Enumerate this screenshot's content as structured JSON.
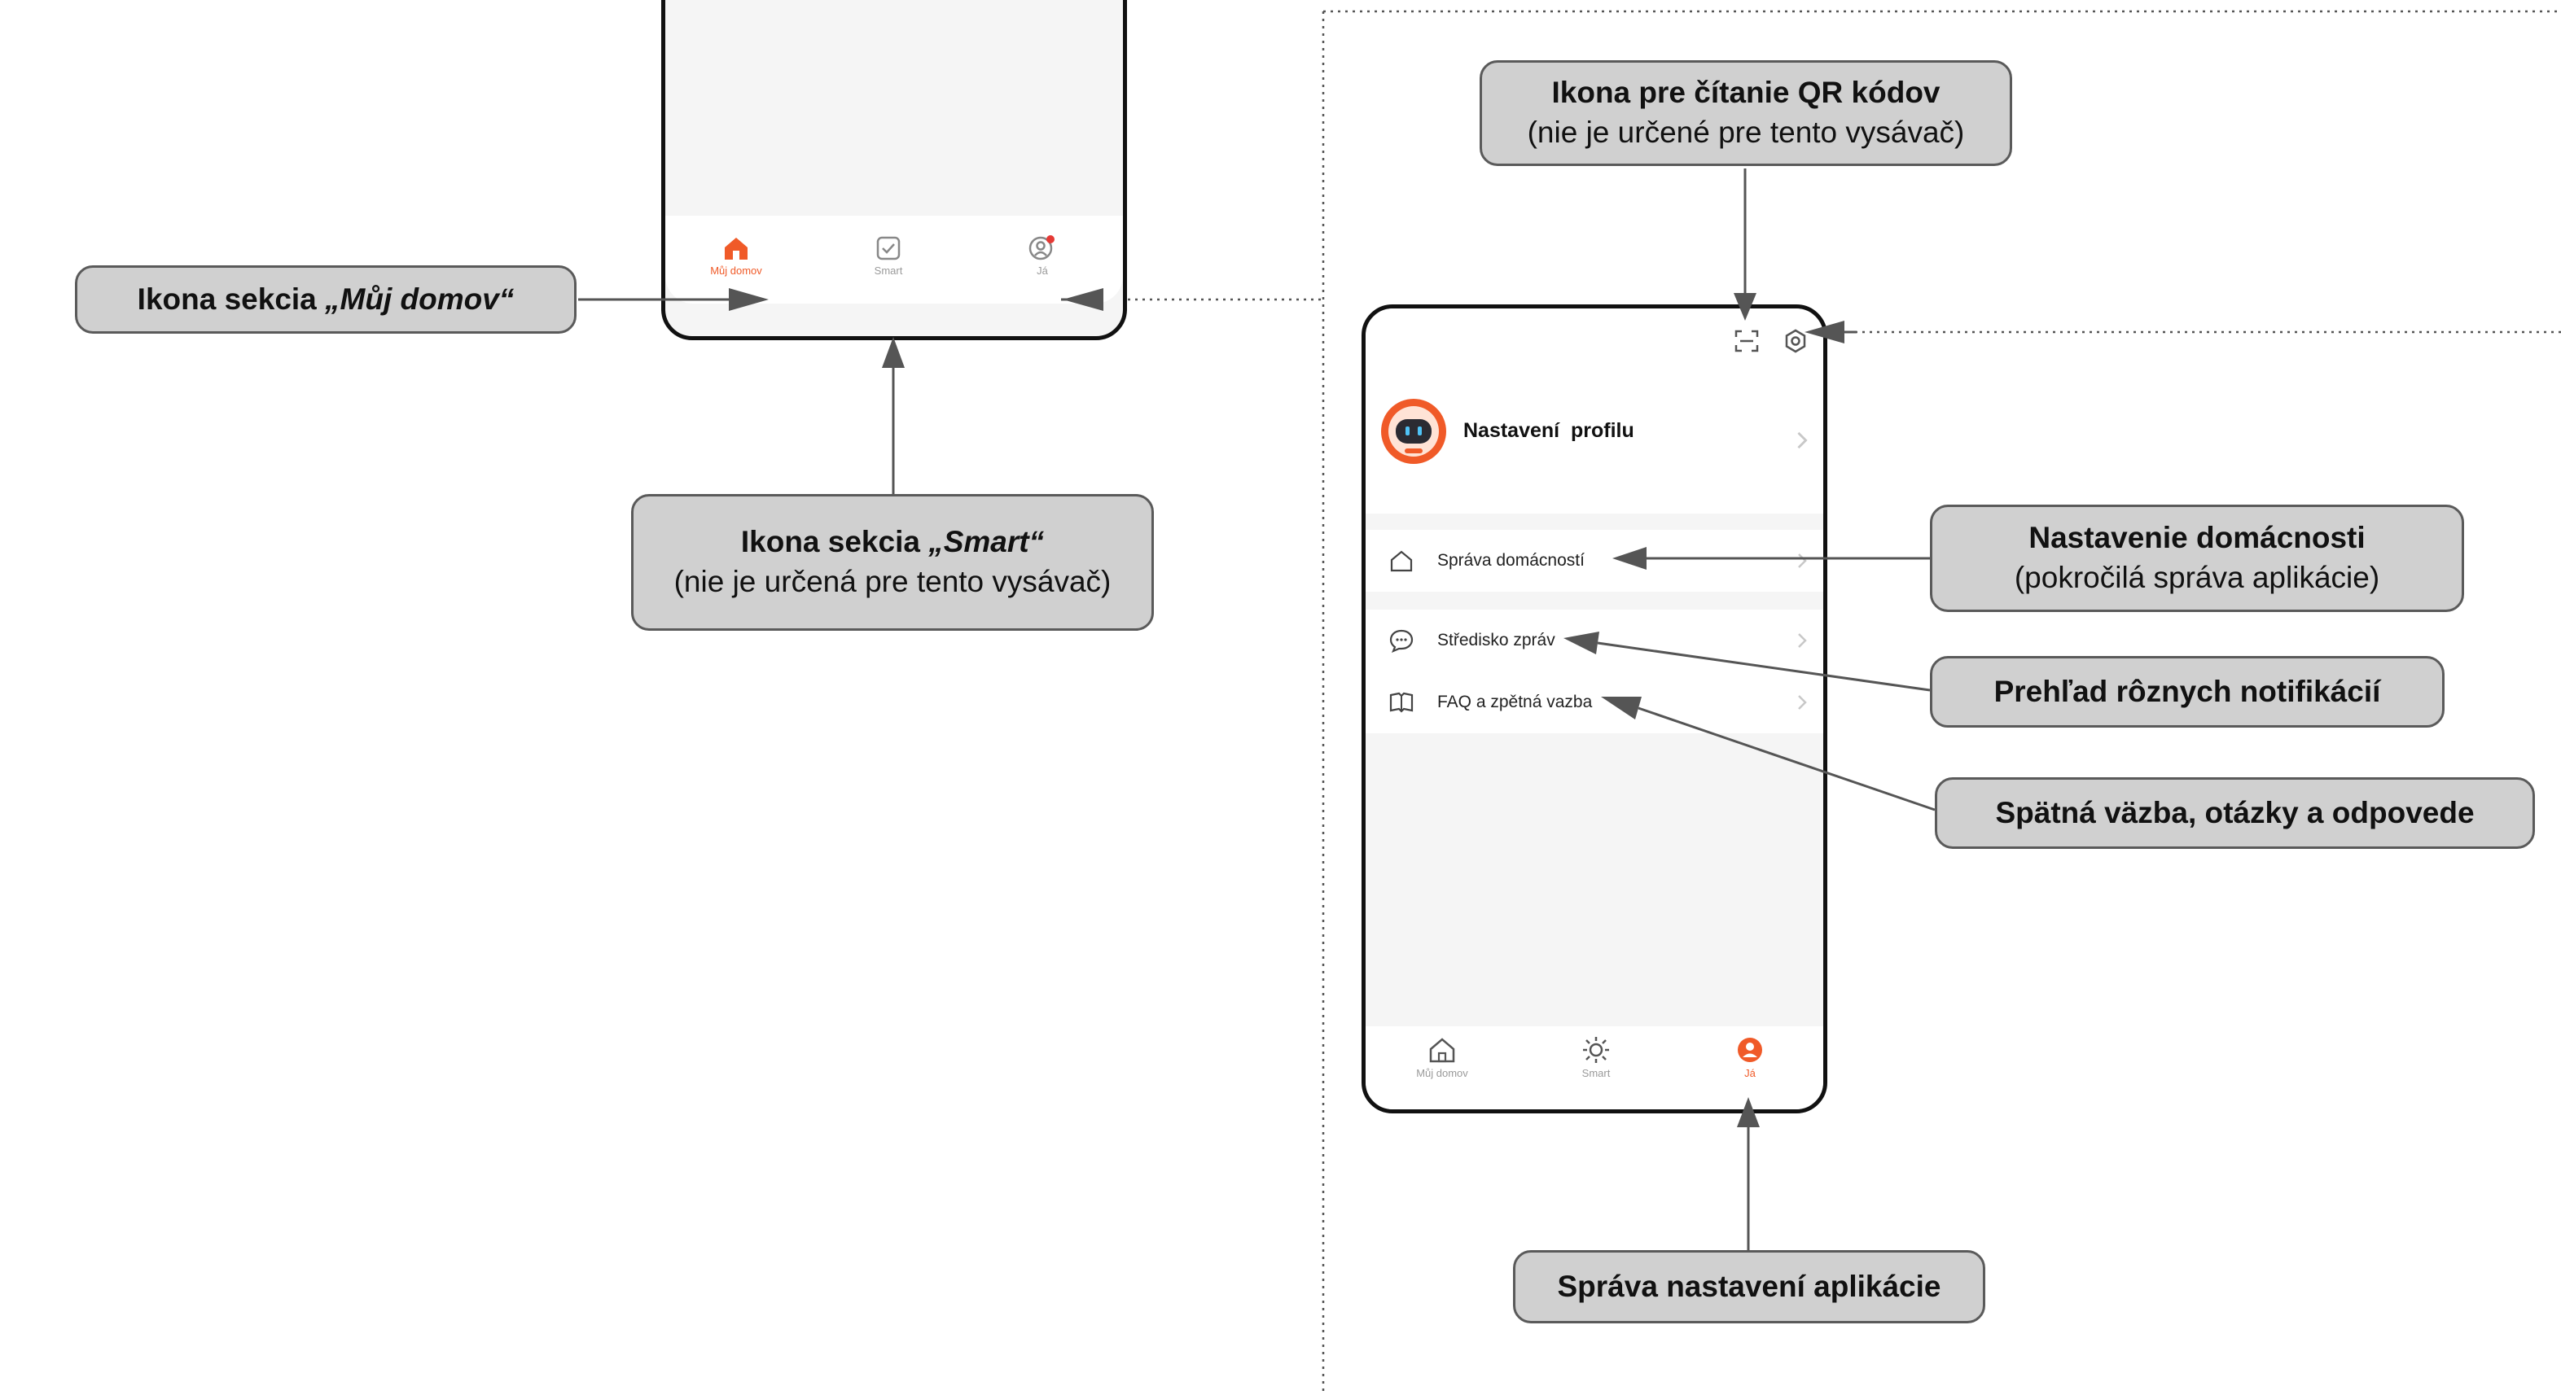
{
  "colors": {
    "accent": "#f05a28",
    "callout_bg": "#d0d0d0",
    "callout_border": "#5a5a5a",
    "arrow": "#555555"
  },
  "callouts": {
    "muj_domov": {
      "prefix": "Ikona sekcia ",
      "name": "„Můj domov“"
    },
    "smart": {
      "prefix": "Ikona sekcia ",
      "name": "„Smart“",
      "sub": "(nie je určená pre tento vysávač)"
    },
    "qr": {
      "title": "Ikona pre čítanie QR kódov",
      "sub": "(nie je určené pre tento vysávač)"
    },
    "household": {
      "title": "Nastavenie domácnosti",
      "sub": "(pokročilá správa aplikácie)"
    },
    "notifications": {
      "title": "Prehľad rôznych notifikácií"
    },
    "feedback": {
      "title": "Spätná väzba, otázky a odpovede"
    },
    "app_settings": {
      "title": "Správa nastavení aplikácie"
    }
  },
  "phone_left": {
    "tabs": [
      {
        "label": "Můj domov",
        "icon": "home-icon",
        "active": true
      },
      {
        "label": "Smart",
        "icon": "smart-checkbox-icon",
        "active": false
      },
      {
        "label": "Já",
        "icon": "profile-icon",
        "active": false
      }
    ]
  },
  "phone_right": {
    "top_icons": [
      "qr-scan-icon",
      "settings-gear-icon"
    ],
    "profile": {
      "title": "Nastavení  profilu",
      "avatar": "robot-avatar-icon"
    },
    "menu": [
      {
        "label": "Správa domácností",
        "icon": "house-outline-icon"
      },
      {
        "label": "Středisko zpráv",
        "icon": "chat-bubble-icon"
      },
      {
        "label": "FAQ a zpětná vazba",
        "icon": "book-icon"
      }
    ],
    "tabs": [
      {
        "label": "Můj domov",
        "icon": "home-outline-icon",
        "active": false
      },
      {
        "label": "Smart",
        "icon": "sun-icon",
        "active": false
      },
      {
        "label": "Já",
        "icon": "profile-filled-icon",
        "active": true
      }
    ]
  }
}
